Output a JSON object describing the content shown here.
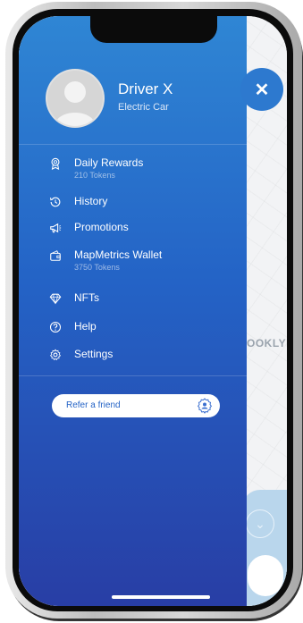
{
  "profile": {
    "name": "Driver X",
    "vehicle": "Electric Car"
  },
  "menu": {
    "items": [
      {
        "label": "Daily Rewards",
        "sub": "210 Tokens",
        "icon": "medal-icon"
      },
      {
        "label": "History",
        "icon": "history-icon"
      },
      {
        "label": "Promotions",
        "icon": "megaphone-icon"
      },
      {
        "label": "MapMetrics Wallet",
        "sub": "3750 Tokens",
        "icon": "wallet-icon"
      },
      {
        "label": "NFTs",
        "icon": "diamond-icon"
      },
      {
        "label": "Help",
        "icon": "help-icon"
      },
      {
        "label": "Settings",
        "icon": "gear-icon"
      }
    ]
  },
  "refer": {
    "label": "Refer a friend",
    "icon": "badge-icon"
  },
  "map": {
    "label": "OOKLYN"
  },
  "close": {
    "symbol": "✕"
  },
  "colors": {
    "drawer_top": "#2f86d4",
    "drawer_bottom": "#283ea5",
    "accent": "#2463c6"
  }
}
